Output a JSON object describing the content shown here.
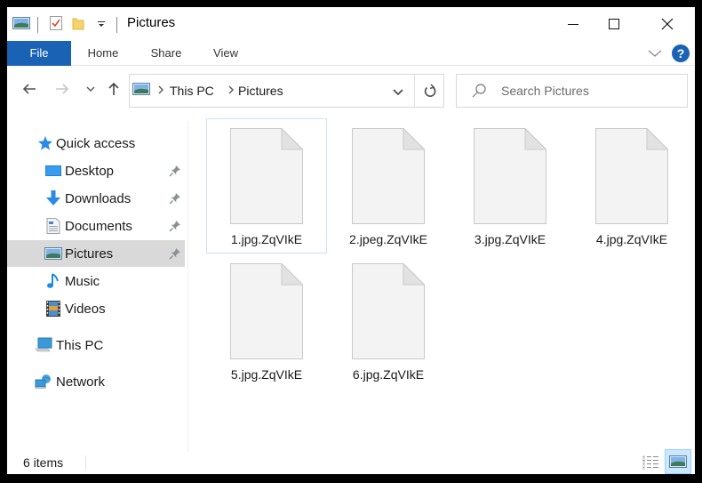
{
  "window": {
    "title": "Pictures",
    "controls": {
      "minimize": "minimize",
      "maximize": "maximize",
      "close": "close"
    }
  },
  "quick_access_toolbar": {
    "icons": [
      "pictures-folder-icon",
      "properties-icon",
      "new-folder-icon",
      "customize-dropdown-icon"
    ]
  },
  "ribbon": {
    "tabs": [
      {
        "label": "File",
        "active": true
      },
      {
        "label": "Home"
      },
      {
        "label": "Share"
      },
      {
        "label": "View"
      }
    ],
    "help_label": "?",
    "accent_color": "#1a62b4"
  },
  "navigation": {
    "breadcrumb": [
      "This PC",
      "Pictures"
    ],
    "search": {
      "placeholder": "Search Pictures",
      "value": ""
    }
  },
  "sidebar": {
    "items": [
      {
        "label": "Quick access",
        "icon": "star-icon",
        "level": 0
      },
      {
        "label": "Desktop",
        "icon": "desktop-icon",
        "level": 1,
        "pinned": true
      },
      {
        "label": "Downloads",
        "icon": "download-icon",
        "level": 1,
        "pinned": true
      },
      {
        "label": "Documents",
        "icon": "documents-icon",
        "level": 1,
        "pinned": true
      },
      {
        "label": "Pictures",
        "icon": "pictures-icon",
        "level": 1,
        "pinned": true,
        "selected": true
      },
      {
        "label": "Music",
        "icon": "music-icon",
        "level": 1
      },
      {
        "label": "Videos",
        "icon": "videos-icon",
        "level": 1
      },
      {
        "label": "This PC",
        "icon": "computer-icon",
        "level": 0
      },
      {
        "label": "Network",
        "icon": "network-icon",
        "level": 0
      }
    ]
  },
  "files": [
    {
      "name": "1.jpg.ZqVIkE",
      "focused": true
    },
    {
      "name": "2.jpeg.ZqVIkE"
    },
    {
      "name": "3.jpg.ZqVIkE"
    },
    {
      "name": "4.jpg.ZqVIkE"
    },
    {
      "name": "5.jpg.ZqVIkE"
    },
    {
      "name": "6.jpg.ZqVIkE"
    }
  ],
  "status": {
    "item_count": "6 items",
    "view_modes": [
      "details",
      "large-icons"
    ],
    "active_view": "large-icons"
  }
}
